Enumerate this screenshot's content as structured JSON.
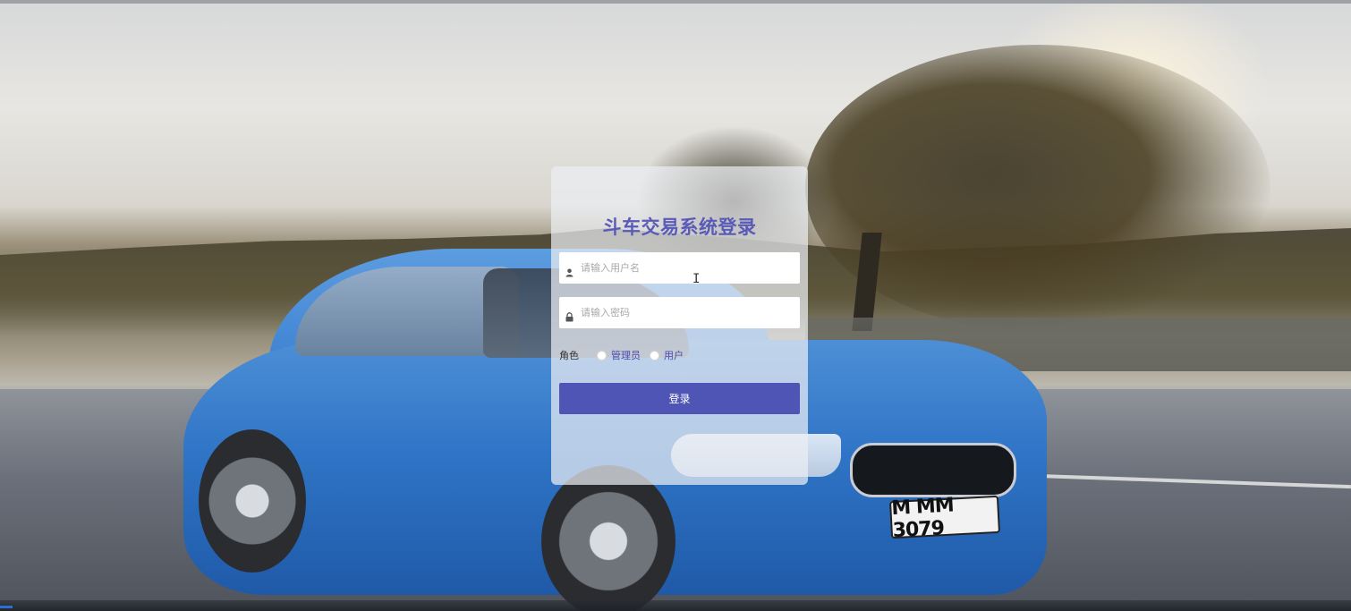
{
  "login": {
    "title": "斗车交易系统登录",
    "username_placeholder": "请输入用户名",
    "password_placeholder": "请输入密码",
    "role_label": "角色",
    "roles": [
      "管理员",
      "用户"
    ],
    "submit_label": "登录"
  },
  "background": {
    "plate_text": "M MM 3079"
  },
  "colors": {
    "title": "#5a5ab8",
    "button": "#4f55b5",
    "role_option": "#4a4ab0"
  },
  "icons": {
    "username": "user-icon",
    "password": "lock-icon"
  }
}
